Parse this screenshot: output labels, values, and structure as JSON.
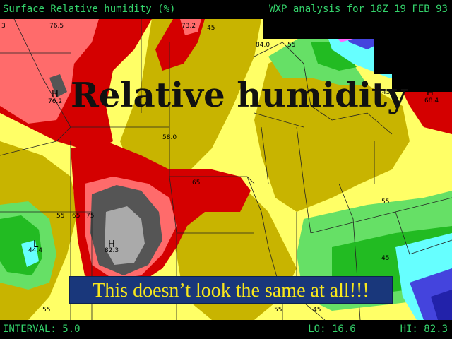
{
  "header": {
    "left": "Surface Relative humidity (%)",
    "right": "WXP analysis for 18Z 19 FEB 93"
  },
  "footer": {
    "interval": "INTERVAL:  5.0",
    "lo": "LO: 16.6",
    "hi": "HI: 82.3"
  },
  "overlays": {
    "title": "Relative humidity",
    "banner": "This doesn’t look the same at all!!!"
  },
  "labels": {
    "l_76_5": "76.5",
    "l_73_2": "73.2",
    "l_84_0": "84.0",
    "l_H1": "H",
    "l_76_2": "76.2",
    "l_58_0": "58.0",
    "l_65": "65",
    "l_55a": "55",
    "l_65b": "65",
    "l_75": "75",
    "l_55b": "55",
    "l_H2": "H",
    "l_82_3": "82.3",
    "l_L1": "L",
    "l_44_4": "44.4",
    "l_55c": "55",
    "l_45a": "45",
    "l_55d": "55",
    "l_45b": "45",
    "l_H3": "H",
    "l_68_4": "68.4",
    "l_45c": "45",
    "l_3": "3",
    "l_45d": "45",
    "l_55e": "55"
  },
  "colors": {
    "header_text": "#34d36b",
    "banner_bg": "#19377b",
    "banner_text": "#f8e71c",
    "yellow": "#ffff66",
    "olive": "#c8b400",
    "red": "#d40000",
    "salmon": "#ff6b6b",
    "dark_gray": "#555555",
    "light_gray": "#aaaaaa",
    "light_green": "#66e066",
    "green": "#22bb22",
    "cyan": "#66ffff",
    "blue": "#4444dd",
    "navy": "#2222aa"
  }
}
